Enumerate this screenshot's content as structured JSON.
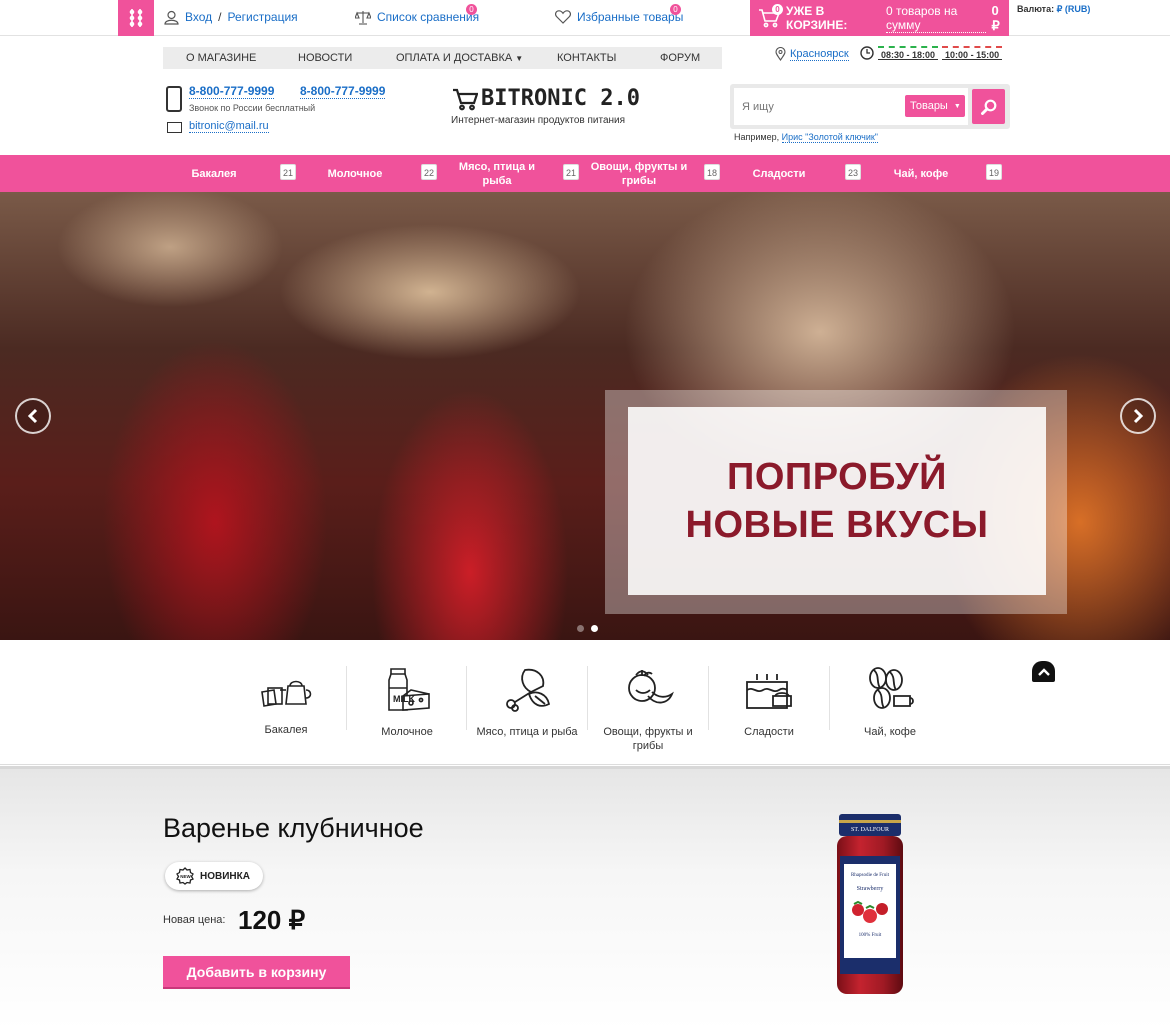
{
  "topbar": {
    "login": "Вход",
    "slash": "/",
    "register": "Регистрация",
    "compare": "Список сравнения",
    "compare_count": "0",
    "favorites": "Избранные товары",
    "favorites_count": "0",
    "cart_count": "0",
    "cart_prefix": "УЖЕ В КОРЗИНЕ:",
    "cart_link": "0 товаров на сумму",
    "cart_sum": "0 ₽",
    "currency_label": "Валюта:",
    "currency_value": "₽ (RUB)"
  },
  "nav": {
    "items": [
      "О МАГАЗИНЕ",
      "НОВОСТИ",
      "ОПЛАТА И ДОСТАВКА",
      "КОНТАКТЫ",
      "ФОРУМ"
    ],
    "city": "Красноярск",
    "hours1": "08:30 - 18:00",
    "hours2": "10:00 - 15:00"
  },
  "contacts": {
    "phone1": "8-800-777-9999",
    "phone2": "8-800-777-9999",
    "phone_note": "Звонок по России бесплатный",
    "email": "bitronic@mail.ru"
  },
  "logo": {
    "name": "BITRONIC 2.0",
    "subtitle": "Интернет-магазин продуктов питания"
  },
  "search": {
    "placeholder": "Я ищу",
    "category": "Товары",
    "hint_prefix": "Например,",
    "hint_link": "Ирис \"Золотой ключик\""
  },
  "categories": [
    {
      "label": "Бакалея",
      "count": "21"
    },
    {
      "label": "Молочное",
      "count": "22"
    },
    {
      "label": "Мясо, птица и рыба",
      "count": "21"
    },
    {
      "label": "Овощи, фрукты и грибы",
      "count": "18"
    },
    {
      "label": "Сладости",
      "count": "23"
    },
    {
      "label": "Чай, кофе",
      "count": "19"
    }
  ],
  "slider": {
    "line1": "ПОПРОБУЙ",
    "line2": "НОВЫЕ ВКУСЫ",
    "slide_count": 2,
    "active_slide": 2
  },
  "icon_categories": [
    {
      "label": "Бакалея",
      "icon": "grocery-icon"
    },
    {
      "label": "Молочное",
      "icon": "dairy-icon"
    },
    {
      "label": "Мясо, птица и рыба",
      "icon": "meat-icon"
    },
    {
      "label": "Овощи, фрукты и грибы",
      "icon": "vegetables-icon"
    },
    {
      "label": "Сладости",
      "icon": "cake-icon"
    },
    {
      "label": "Чай, кофе",
      "icon": "coffee-icon"
    }
  ],
  "product": {
    "title": "Варенье клубничное",
    "badge": "НОВИНКА",
    "price_label": "Новая цена:",
    "price": "120 ₽",
    "add_to_cart": "Добавить в корзину",
    "jar_brand": "ST. DALFOUR",
    "jar_label1": "Rhapsodie de Fruit",
    "jar_label2": "Strawberry",
    "jar_label3": "100% Fruit"
  },
  "colors": {
    "accent": "#f0529b",
    "link": "#1a6ec7",
    "slide_title": "#8b1a2b"
  }
}
